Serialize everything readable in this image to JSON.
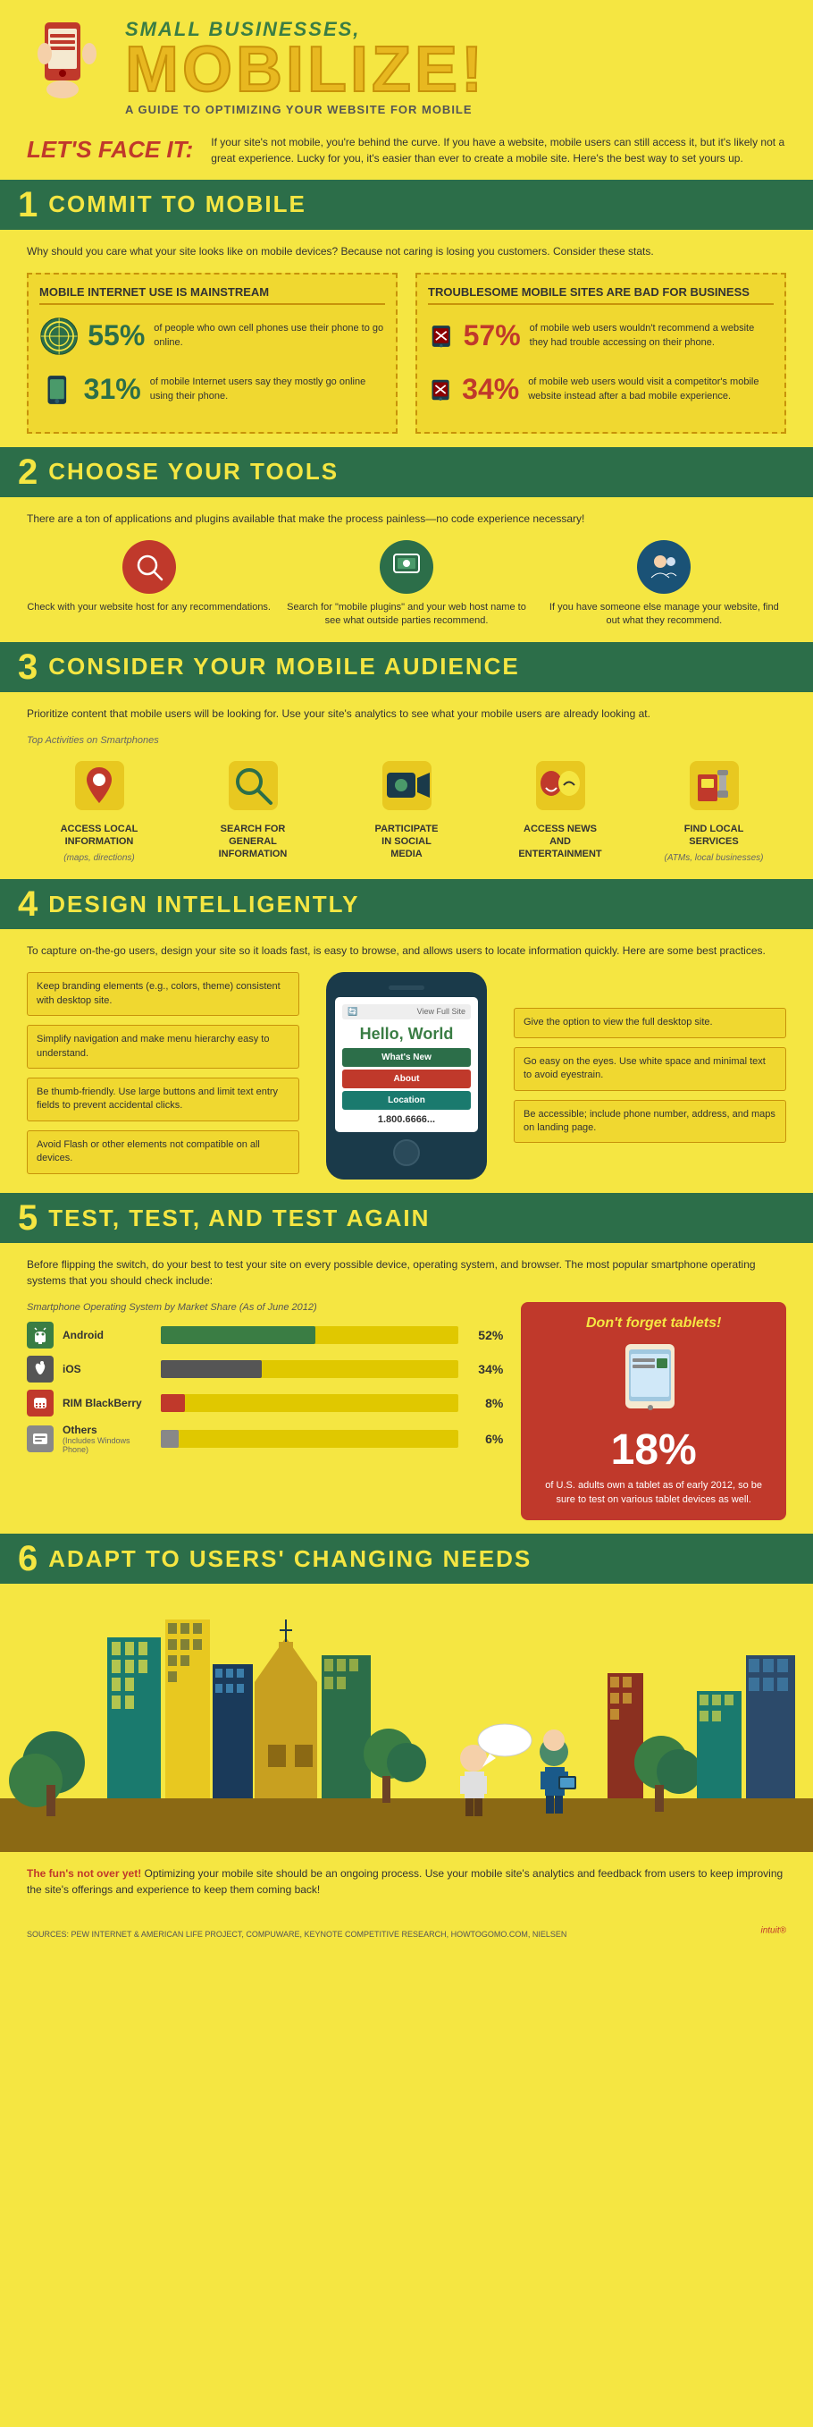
{
  "header": {
    "title_small": "Small Businesses,",
    "title_big": "Mobilize!",
    "subtitle": "A Guide to Optimizing Your Website for Mobile",
    "intro_label": "Let's face it:",
    "intro_text": "If your site's not mobile, you're behind the curve. If you have a website, mobile users can still access it, but it's likely not a great experience. Lucky for you, it's easier than ever to create a mobile site. Here's the best way to set yours up."
  },
  "section1": {
    "number": "1",
    "title": "Commit to Mobile",
    "intro": "Why should you care what your site looks like on mobile devices? Because not caring is losing you customers. Consider these stats.",
    "col1_title": "Mobile Internet Use is Mainstream",
    "col2_title": "Troublesome Mobile Sites are Bad for Business",
    "stat1_pct": "55%",
    "stat1_text": "of people who own cell phones use their phone to go online.",
    "stat2_pct": "31%",
    "stat2_text": "of mobile Internet users say they mostly go online using their phone.",
    "stat3_pct": "57%",
    "stat3_text": "of mobile web users wouldn't recommend a website they had trouble accessing on their phone.",
    "stat4_pct": "34%",
    "stat4_text": "of mobile web users would visit a competitor's mobile website instead after a bad mobile experience."
  },
  "section2": {
    "number": "2",
    "title": "Choose Your Tools",
    "intro": "There are a ton of applications and plugins available that make the process painless—no code experience necessary!",
    "tool1_text": "Check with your website host for any recommendations.",
    "tool2_text": "Search for \"mobile plugins\" and your web host name to see what outside parties recommend.",
    "tool3_text": "If you have someone else manage your website, find out what they recommend."
  },
  "section3": {
    "number": "3",
    "title": "Consider Your Mobile Audience",
    "intro": "Prioritize content that mobile users will be looking for. Use your site's analytics to see what your mobile users are already looking at.",
    "top_activities": "Top Activities on Smartphones",
    "items": [
      {
        "label": "Access Local Information",
        "sublabel": "(maps, directions)",
        "icon": "📍"
      },
      {
        "label": "Search for General Information",
        "sublabel": "",
        "icon": "🔍"
      },
      {
        "label": "Participate in Social Media",
        "sublabel": "",
        "icon": "🎬"
      },
      {
        "label": "Access News and Entertainment",
        "sublabel": "",
        "icon": "🎭"
      },
      {
        "label": "Find Local Services",
        "sublabel": "(ATMs, local businesses)",
        "icon": "⛽"
      }
    ]
  },
  "section4": {
    "number": "4",
    "title": "Design Intelligently",
    "intro": "To capture on-the-go users, design your site so it loads fast, is easy to browse, and allows users to locate information quickly. Here are some best practices.",
    "tips_left": [
      "Keep branding elements (e.g., colors, theme) consistent with desktop site.",
      "Simplify navigation and make menu hierarchy easy to understand.",
      "Be thumb-friendly. Use large buttons and limit text entry fields to prevent accidental clicks.",
      "Avoid Flash or other elements not compatible on all devices."
    ],
    "tips_right": [
      "Give the option to view the full desktop site.",
      "Go easy on the eyes. Use white space and minimal text to avoid eyestrain.",
      "Be accessible; include phone number, address, and maps on landing page."
    ],
    "phone_url": "View Full Site",
    "phone_hello": "Hello, World",
    "phone_btn1": "What's New",
    "phone_btn2": "About",
    "phone_btn3": "Location",
    "phone_number": "1.800.6666..."
  },
  "section5": {
    "number": "5",
    "title": "Test, Test, and Test Again",
    "intro": "Before flipping the switch, do your best to test your site on every possible device, operating system, and browser. The most popular smartphone operating systems that you should check include:",
    "chart_title": "Smartphone Operating System by Market Share (As of June 2012)",
    "bars": [
      {
        "label": "Android",
        "sublabel": "",
        "pct": 52,
        "pct_label": "52%",
        "color": "#3a7d44"
      },
      {
        "label": "iOS",
        "sublabel": "",
        "pct": 34,
        "pct_label": "34%",
        "color": "#555"
      },
      {
        "label": "RIM BlackBerry",
        "sublabel": "",
        "pct": 8,
        "pct_label": "8%",
        "color": "#c0392b"
      },
      {
        "label": "Others",
        "sublabel": "(Includes Windows Phone)",
        "pct": 6,
        "pct_label": "6%",
        "color": "#888"
      }
    ],
    "dont_forget": "Don't forget tablets!",
    "tablet_pct": "18%",
    "tablet_text": "of U.S. adults own a tablet as of early 2012, so be sure to test on various tablet devices as well."
  },
  "section6": {
    "number": "6",
    "title": "Adapt to Users' Changing Needs",
    "highlight": "The fun's not over yet!",
    "text": " Optimizing your mobile site should be an ongoing process. Use your mobile site's analytics and feedback from users to keep improving the site's offerings and experience to keep them coming back!"
  },
  "footer": {
    "sources": "SOURCES: PEW INTERNET & AMERICAN LIFE PROJECT, COMPUWARE, KEYNOTE COMPETITIVE RESEARCH, HOWTOGOMO.COM, NIELSEN",
    "logo": "intuit"
  }
}
